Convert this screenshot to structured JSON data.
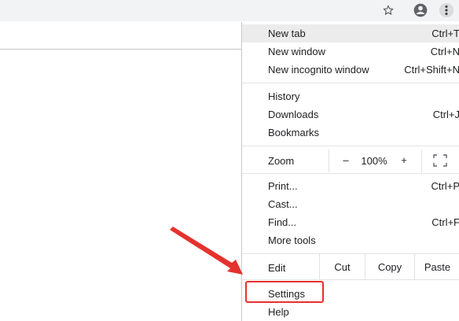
{
  "toolbar": {
    "bookmark_icon": "star-icon",
    "profile_icon": "account-circle-icon",
    "menu_icon": "three-dots-vertical-icon"
  },
  "menu": {
    "groups": [
      [
        {
          "label": "New tab",
          "shortcut": "Ctrl+T"
        },
        {
          "label": "New window",
          "shortcut": "Ctrl+N"
        },
        {
          "label": "New incognito window",
          "shortcut": "Ctrl+Shift+N"
        }
      ],
      [
        {
          "label": "History",
          "submenu": true
        },
        {
          "label": "Downloads",
          "shortcut": "Ctrl+J"
        },
        {
          "label": "Bookmarks",
          "submenu": true
        }
      ]
    ],
    "zoom": {
      "label": "Zoom",
      "minus": "–",
      "value": "100%",
      "plus": "+"
    },
    "group3": [
      {
        "label": "Print...",
        "shortcut": "Ctrl+P"
      },
      {
        "label": "Cast..."
      },
      {
        "label": "Find...",
        "shortcut": "Ctrl+F"
      },
      {
        "label": "More tools",
        "submenu": true
      }
    ],
    "edit": {
      "label": "Edit",
      "cut": "Cut",
      "copy": "Copy",
      "paste": "Paste"
    },
    "settings": {
      "label": "Settings"
    },
    "partial": {
      "label": "Help"
    }
  },
  "colors": {
    "highlight_box": "#e5322d",
    "hover_row": "#ececec"
  }
}
